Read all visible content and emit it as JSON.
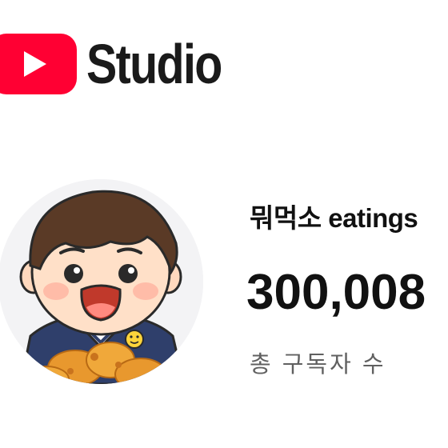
{
  "header": {
    "brand_text": "Studio",
    "logo_icon": "youtube-play-icon",
    "brand_color": "#ff0000"
  },
  "channel": {
    "name": "뭐먹소 eatings",
    "avatar_icon": "cartoon-boy-eating-chicken",
    "subscriber_count": "300,008",
    "subscriber_label": "총 구독자 수"
  },
  "colors": {
    "text_primary": "#111111",
    "text_secondary": "#606060",
    "background": "#ffffff"
  }
}
